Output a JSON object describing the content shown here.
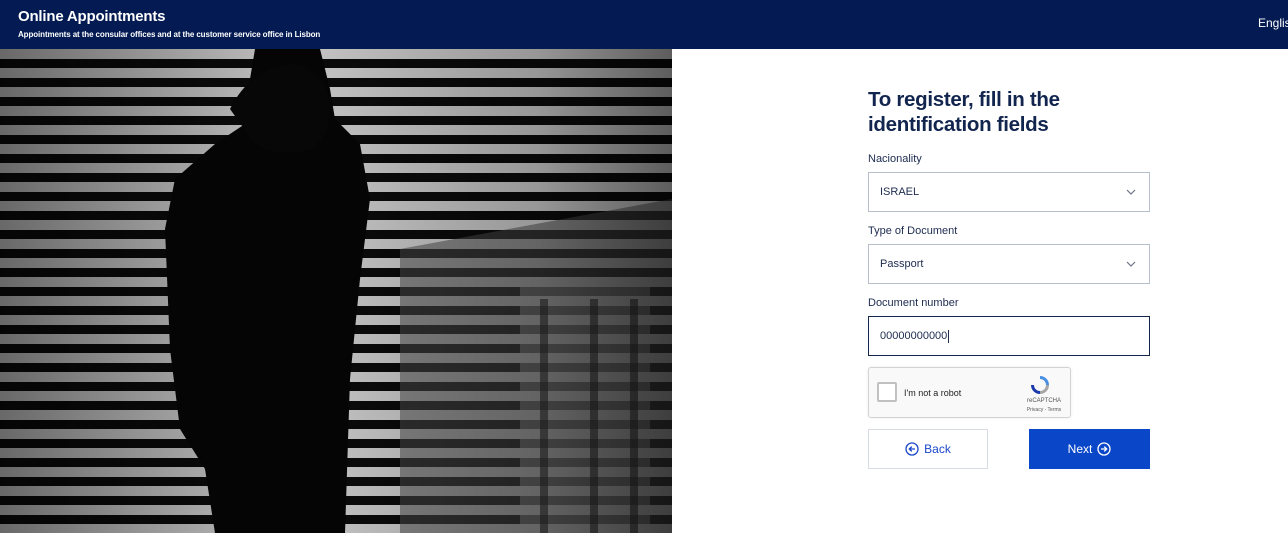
{
  "header": {
    "title": "Online Appointments",
    "subtitle": "Appointments at the consular offices and at the customer service office in Lisbon",
    "language": "English"
  },
  "form": {
    "heading": "To register, fill in the identification fields",
    "nationality": {
      "label": "Nacionality",
      "value": "ISRAEL"
    },
    "document_type": {
      "label": "Type of Document",
      "value": "Passport"
    },
    "document_number": {
      "label": "Document number",
      "value": "00000000000"
    },
    "captcha": {
      "label": "I'm not a robot",
      "brand": "reCAPTCHA",
      "terms": "Privacy - Terms"
    },
    "back_label": "Back",
    "next_label": "Next"
  },
  "colors": {
    "header_bg": "#031b52",
    "primary": "#0a46c8",
    "heading": "#12254e"
  },
  "icons": {
    "back": "arrow-left-circle-icon",
    "next": "arrow-right-circle-icon",
    "dropdown": "chevron-down-icon"
  }
}
